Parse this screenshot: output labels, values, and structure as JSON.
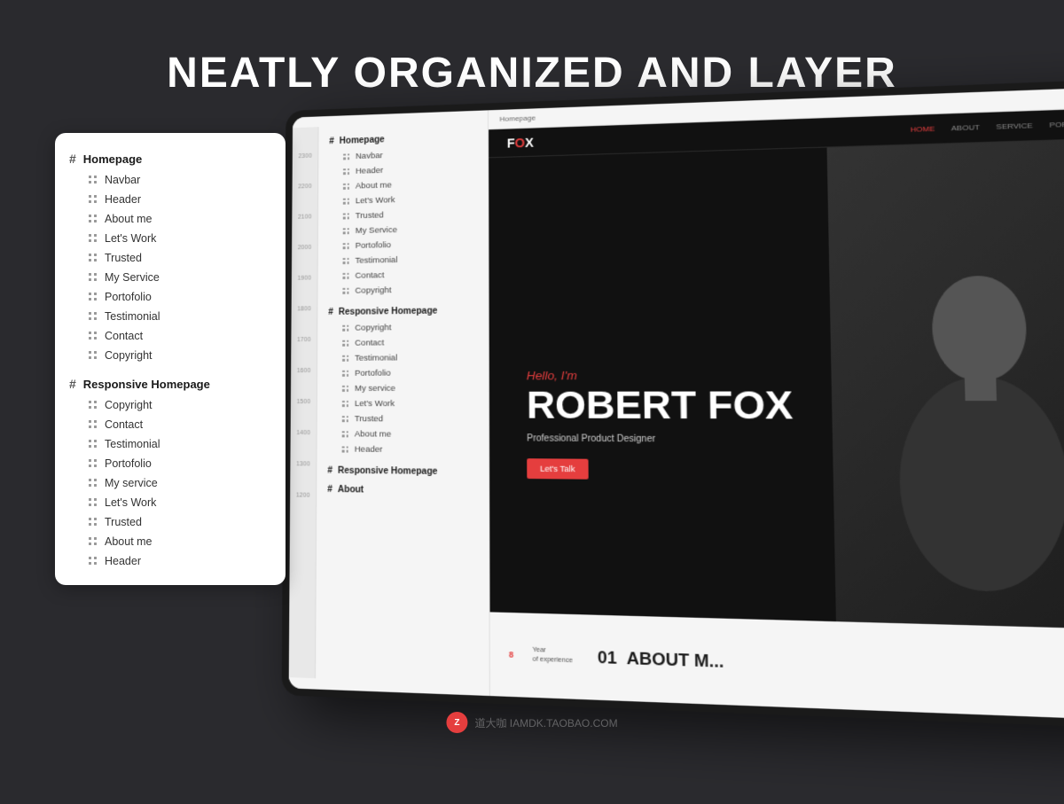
{
  "page": {
    "title": "NEATLY ORGANIZED AND LAYER",
    "background_color": "#2a2a2e"
  },
  "layer_panel": {
    "groups": [
      {
        "label": "Homepage",
        "items": [
          "Navbar",
          "Header",
          "About me",
          "Let's Work",
          "Trusted",
          "My Service",
          "Portofolio",
          "Testimonial",
          "Contact",
          "Copyright"
        ]
      },
      {
        "label": "Responsive Homepage",
        "items": [
          "Copyright",
          "Contact",
          "Testimonial",
          "Portofolio",
          "My service",
          "Let's Work",
          "Trusted",
          "About me",
          "Header"
        ]
      }
    ]
  },
  "tablet_panel": {
    "groups": [
      {
        "label": "Homepage",
        "items": [
          "Navbar",
          "Header",
          "About me",
          "Let's Work",
          "Trusted",
          "My Service",
          "Portofolio",
          "Testimonial",
          "Contact",
          "Copyright"
        ]
      },
      {
        "label": "Responsive Homepage",
        "items": [
          "Copyright",
          "Contact",
          "Testimonial",
          "Portofolio",
          "My service",
          "Let's Work",
          "Trusted",
          "About me",
          "Header"
        ]
      },
      {
        "label": "Responsive Homepage",
        "items": []
      },
      {
        "label": "About",
        "items": []
      }
    ],
    "ruler_numbers": [
      "2300",
      "2200",
      "2100",
      "2000",
      "1900",
      "1800",
      "1700",
      "1600",
      "1500",
      "1400",
      "1300",
      "1200"
    ]
  },
  "website_preview": {
    "logo": "FOX",
    "logo_highlight": "O",
    "breadcrumb": "Homepage",
    "nav_links": [
      "HOME",
      "ABOUT",
      "SERVICE",
      "PORTOFOLIO"
    ],
    "active_nav": "HOME",
    "hero": {
      "greeting": "Hello, I'm",
      "name": "ROBERT FOX",
      "title": "Professional Product Designer",
      "button_label": "Let's Talk"
    },
    "about_section": {
      "number": "01",
      "stat_number": "8",
      "stat_label": "Year\nof experience",
      "title": "ABOUT M..."
    }
  },
  "watermark": {
    "icon": "Z",
    "text": "道大咖  IAMDK.TAOBAO.COM"
  }
}
